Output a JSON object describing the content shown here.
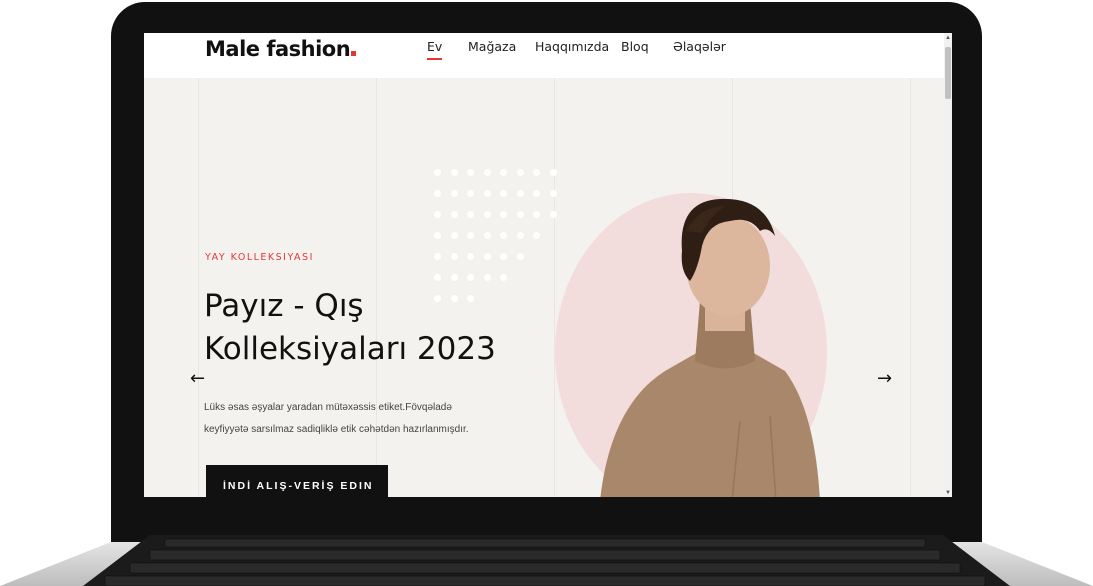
{
  "site": {
    "logo_text": "Male fashion",
    "nav": [
      {
        "label": "Ev",
        "active": true
      },
      {
        "label": "Mağaza",
        "active": false
      },
      {
        "label": "Haqqımızda",
        "active": false
      },
      {
        "label": "Bloq",
        "active": false
      },
      {
        "label": "Əlaqələr",
        "active": false
      }
    ]
  },
  "hero": {
    "eyebrow": "YAY KOLLEKSIYASI",
    "title_line1": "Payız - Qış",
    "title_line2": "Kolleksiyaları 2023",
    "desc_line1": "Lüks əsas əşyalar yaradan mütəxəssis etiket.Fövqəladə",
    "desc_line2": "keyfiyyətə sarsılmaz sadiqliklə etik cəhətdən hazırlanmışdır.",
    "cta_label": "İNDİ ALIŞ-VERİŞ EDIN",
    "prev_arrow": "←",
    "next_arrow": "→"
  },
  "colors": {
    "accent": "#e53637",
    "hero_bg": "#f3f2ee",
    "circle": "#f2dcdc",
    "laptop": "#111111"
  },
  "icons": {
    "prev": "arrow-left-icon",
    "next": "arrow-right-icon",
    "cta": "arrow-right-icon"
  }
}
